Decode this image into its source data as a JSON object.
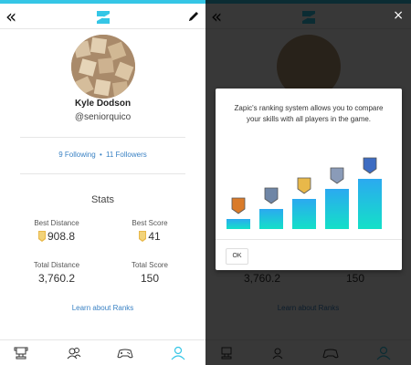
{
  "profile": {
    "name": "Kyle Dodson",
    "handle": "@seniorquico",
    "following": "9 Following",
    "separator": "•",
    "followers": "11 Followers"
  },
  "stats": {
    "title": "Stats",
    "best_distance_label": "Best Distance",
    "best_distance_value": "908.8",
    "best_score_label": "Best Score",
    "best_score_value": "41",
    "total_distance_label": "Total Distance",
    "total_distance_value": "3,760.2",
    "total_score_label": "Total Score",
    "total_score_value": "150"
  },
  "learn_ranks": "Learn about Ranks",
  "icons": {
    "back": "double-chevron-left-icon",
    "logo": "zapic-logo-icon",
    "edit": "pencil-icon",
    "close": "close-icon",
    "nav": [
      "trophy-icon",
      "friends-icon",
      "gamepad-icon",
      "profile-icon"
    ]
  },
  "dialog": {
    "text": "Zapic's ranking system allows you to compare your skills with all players in the game.",
    "ok": "OK",
    "rank_levels": [
      1,
      2,
      3,
      4,
      5
    ]
  },
  "colors": {
    "accent": "#35c6e6",
    "link": "#3a82c4",
    "badge_gold": "#e8b84a",
    "active_nav": "#35c6e6"
  },
  "back_glyph": "«",
  "close_glyph": "×"
}
